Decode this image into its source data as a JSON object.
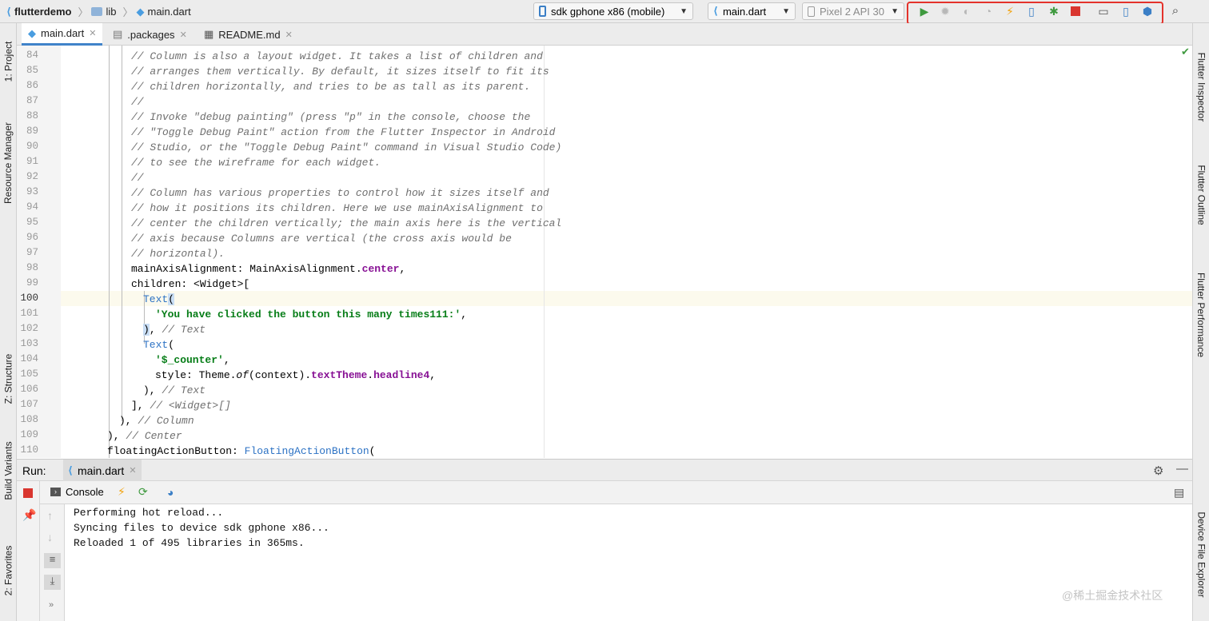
{
  "breadcrumb": {
    "project": "flutterdemo",
    "folder": "lib",
    "file": "main.dart"
  },
  "toolbar": {
    "device": "sdk gphone x86 (mobile)",
    "run_config": "main.dart",
    "avd": "Pixel 2 API 30"
  },
  "tabs": [
    {
      "label": "main.dart"
    },
    {
      "label": ".packages"
    },
    {
      "label": "README.md"
    }
  ],
  "left_tool_windows": [
    "1: Project",
    "Resource Manager",
    "Z: Structure",
    "Build Variants",
    "2: Favorites"
  ],
  "right_tool_windows": [
    "Flutter Inspector",
    "Flutter Outline",
    "Flutter Performance",
    "Device File Explorer"
  ],
  "code": {
    "line_numbers": [
      "84",
      "85",
      "86",
      "87",
      "88",
      "89",
      "90",
      "91",
      "92",
      "93",
      "94",
      "95",
      "96",
      "97",
      "98",
      "99",
      "100",
      "101",
      "102",
      "103",
      "104",
      "105",
      "106",
      "107",
      "108",
      "109",
      "110"
    ],
    "current_line": "100",
    "comments": [
      "// Column is also a layout widget. It takes a list of children and",
      "// arranges them vertically. By default, it sizes itself to fit its",
      "// children horizontally, and tries to be as tall as its parent.",
      "//",
      "// Invoke \"debug painting\" (press \"p\" in the console, choose the",
      "// \"Toggle Debug Paint\" action from the Flutter Inspector in Android",
      "// Studio, or the \"Toggle Debug Paint\" command in Visual Studio Code)",
      "// to see the wireframe for each widget.",
      "//",
      "// Column has various properties to control how it sizes itself and",
      "// how it positions its children. Here we use mainAxisAlignment to",
      "// center the children vertically; the main axis here is the vertical",
      "// axis because Columns are vertical (the cross axis would be",
      "// horizontal)."
    ],
    "l98_prop": "mainAxisAlignment: MainAxisAlignment.",
    "l98_field": "center",
    "l98_end": ",",
    "l99": "children: <Widget>[",
    "l100_cls": "Text",
    "l100_paren": "(",
    "l101_str": "'You have clicked the button this many times111:'",
    "l101_end": ",",
    "l102_close": ")",
    "l102_end": ",",
    "l102_cm": "// Text",
    "l103_cls": "Text",
    "l103_paren": "(",
    "l104_str": "'$_counter'",
    "l104_end": ",",
    "l105_a": "style: Theme.",
    "l105_of": "of",
    "l105_b": "(context).",
    "l105_f1": "textTheme",
    "l105_dot": ".",
    "l105_f2": "headline4",
    "l105_end": ",",
    "l106": "),",
    "l106_cm": "// Text",
    "l107": "],",
    "l107_cm": "// <Widget>[]",
    "l108": "),",
    "l108_cm": "// Column",
    "l109": "),",
    "l109_cm": "// Center",
    "l110_a": "floatingActionButton: ",
    "l110_cls": "FloatingActionButton",
    "l110_end": "("
  },
  "run_panel": {
    "title": "Run:",
    "tab": "main.dart",
    "console_tab": "Console",
    "output": [
      "Performing hot reload...",
      "Syncing files to device sdk gphone x86...",
      "Reloaded 1 of 495 libraries in 365ms."
    ]
  },
  "watermark": "@稀土掘金技术社区",
  "colors": {
    "highlight_border": "#e4322b",
    "run_green": "#3f9a3f",
    "stop_red": "#d9362f",
    "flutter_blue": "#4a9de0"
  }
}
